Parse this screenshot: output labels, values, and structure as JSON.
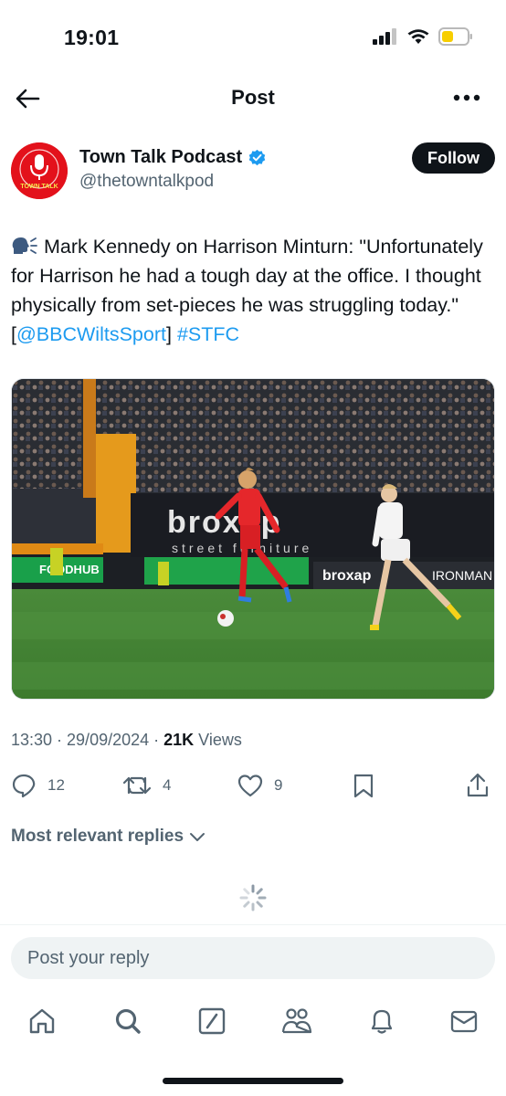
{
  "status_bar": {
    "time": "19:01",
    "signal_icon": "signal-bars-icon",
    "wifi_icon": "wifi-icon",
    "battery_icon": "battery-low-icon",
    "battery_color": "#f7ce00"
  },
  "header": {
    "title": "Post",
    "back_icon": "arrow-left-icon",
    "more_icon": "more-horizontal-icon"
  },
  "author": {
    "name": "Town Talk Podcast",
    "handle": "@thetowntalkpod",
    "verified_icon": "verified-badge-icon",
    "verified_color": "#1d9bf0",
    "avatar_text": "TOWN TALK",
    "avatar_color": "#e3111b",
    "follow_label": "Follow"
  },
  "post": {
    "emoji_icon": "speaking-head-icon",
    "text_main": " Mark Kennedy on Harrison Minturn: \"Unfortunately for Harrison he had a tough day at the office. I thought physically from set-pieces he was struggling today.\" [",
    "mention": "@BBCWiltsSport",
    "text_mid": "] ",
    "hashtag": "#STFC",
    "link_color": "#1d9bf0"
  },
  "media": {
    "board_text_1": "broxap",
    "board_text_2": "street furniture",
    "board_text_3": "broxap",
    "board_text_4": "IRONMAN",
    "board_text_5": "FOODHUB"
  },
  "meta": {
    "timestamp": "13:30 · 29/09/2024 · ",
    "views_count": "21K",
    "views_label": " Views"
  },
  "actions": {
    "replies": "12",
    "reposts": "4",
    "likes": "9",
    "reply_icon": "comment-icon",
    "repost_icon": "repost-icon",
    "like_icon": "heart-icon",
    "bookmark_icon": "bookmark-icon",
    "share_icon": "share-icon"
  },
  "replies_sort": {
    "label": "Most relevant replies",
    "icon": "chevron-down-icon"
  },
  "reply_input": {
    "placeholder": "Post your reply"
  },
  "tabs": [
    {
      "name": "home",
      "icon": "home-icon"
    },
    {
      "name": "search",
      "icon": "search-icon"
    },
    {
      "name": "grok",
      "icon": "grok-icon"
    },
    {
      "name": "communities",
      "icon": "communities-icon"
    },
    {
      "name": "notifications",
      "icon": "bell-icon"
    },
    {
      "name": "messages",
      "icon": "mail-icon"
    }
  ]
}
